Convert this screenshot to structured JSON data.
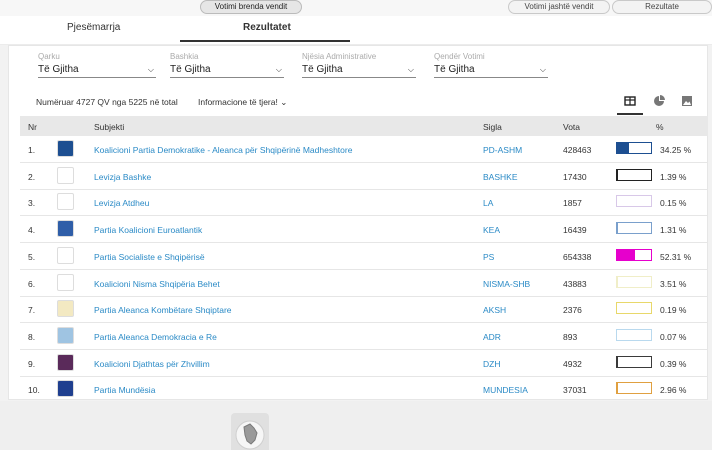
{
  "top_nav": {
    "inside": "Votimi brenda vendit",
    "outside": "Votimi jashtë vendit",
    "results": "Rezultate"
  },
  "tabs": {
    "participation": "Pjesëmarrja",
    "results": "Rezultatet"
  },
  "filters": [
    {
      "label": "Qarku",
      "value": "Të Gjitha"
    },
    {
      "label": "Bashkia",
      "value": "Të Gjitha"
    },
    {
      "label": "Njësia Administrative",
      "value": "Të Gjitha"
    },
    {
      "label": "Qendër Votimi",
      "value": "Të Gjitha"
    }
  ],
  "summary": "Numëruar 4727 QV nga 5225 në total",
  "more_info": "Informacione të tjera!",
  "table": {
    "headers": {
      "nr": "Nr",
      "subject": "Subjekti",
      "sigla": "Sigla",
      "vota": "Vota",
      "pct": "%"
    },
    "rows": [
      {
        "nr": "1.",
        "name": "Koalicioni Partia Demokratike - Aleanca për Shqipërinë Madheshtore",
        "sigla": "PD-ASHM",
        "vota": "428463",
        "pct": "34.25 %",
        "share": 0.3425,
        "bar_color": "#1d4f91",
        "logo_color": "#1d4f91",
        "logo_icon": "pd-logo-icon"
      },
      {
        "nr": "2.",
        "name": "Levizja Bashke",
        "sigla": "BASHKE",
        "vota": "17430",
        "pct": "1.39 %",
        "share": 0.0139,
        "bar_color": "#222222",
        "logo_color": "#ffffff",
        "logo_icon": "bashke-logo-icon"
      },
      {
        "nr": "3.",
        "name": "Levizja Atdheu",
        "sigla": "LA",
        "vota": "1857",
        "pct": "0.15 %",
        "share": 0.0015,
        "bar_color": "#d8c8e8",
        "logo_color": "#ffffff",
        "logo_icon": "la-logo-icon"
      },
      {
        "nr": "4.",
        "name": "Partia Koalicioni Euroatlantik",
        "sigla": "KEA",
        "vota": "16439",
        "pct": "1.31 %",
        "share": 0.0131,
        "bar_color": "#7aa0cc",
        "logo_color": "#2f5ea8",
        "logo_icon": "kea-logo-icon"
      },
      {
        "nr": "5.",
        "name": "Partia Socialiste e Shqipërisë",
        "sigla": "PS",
        "vota": "654338",
        "pct": "52.31 %",
        "share": 0.5231,
        "bar_color": "#e600cc",
        "logo_color": "#ffffff",
        "logo_icon": "ps-logo-icon"
      },
      {
        "nr": "6.",
        "name": "Koalicioni Nisma Shqipëria Behet",
        "sigla": "NISMA-SHB",
        "vota": "43883",
        "pct": "3.51 %",
        "share": 0.0351,
        "bar_color": "#f0eec8",
        "logo_color": "#ffffff",
        "logo_icon": "nisma-logo-icon"
      },
      {
        "nr": "7.",
        "name": "Partia Aleanca Kombëtare Shqiptare",
        "sigla": "AKSH",
        "vota": "2376",
        "pct": "0.19 %",
        "share": 0.0019,
        "bar_color": "#e8d86a",
        "logo_color": "#f3e9c2",
        "logo_icon": "aksh-logo-icon"
      },
      {
        "nr": "8.",
        "name": "Partia Aleanca Demokracia e Re",
        "sigla": "ADR",
        "vota": "893",
        "pct": "0.07 %",
        "share": 0.0007,
        "bar_color": "#b9d9ee",
        "logo_color": "#9fc4e2",
        "logo_icon": "adr-logo-icon"
      },
      {
        "nr": "9.",
        "name": "Koalicioni Djathtas për Zhvillim",
        "sigla": "DZH",
        "vota": "4932",
        "pct": "0.39 %",
        "share": 0.0039,
        "bar_color": "#3a3a3a",
        "logo_color": "#5a2a5a",
        "logo_icon": "dzh-logo-icon"
      },
      {
        "nr": "10.",
        "name": "Partia Mundësia",
        "sigla": "MUNDESIA",
        "vota": "37031",
        "pct": "2.96 %",
        "share": 0.0296,
        "bar_color": "#e0a040",
        "logo_color": "#1f3f8f",
        "logo_icon": "mundesia-logo-icon"
      }
    ]
  }
}
